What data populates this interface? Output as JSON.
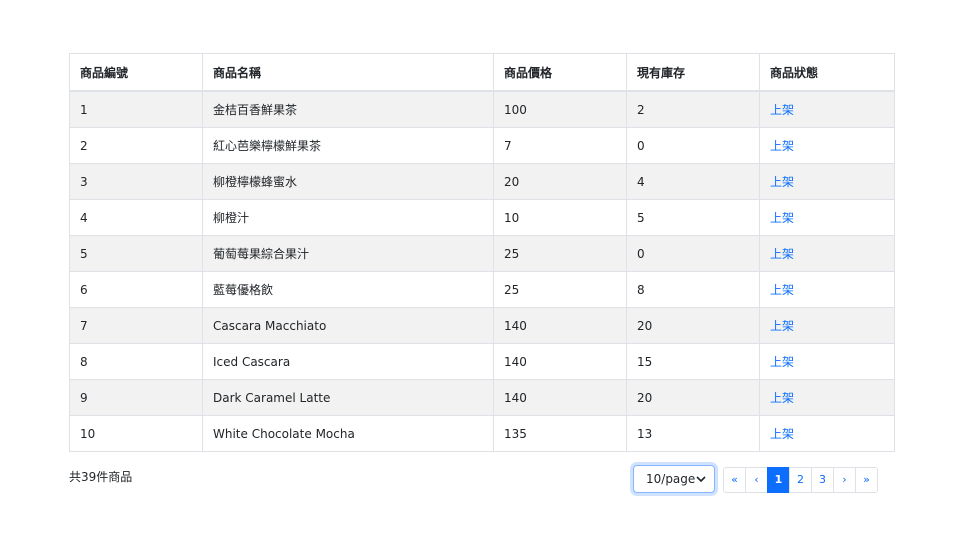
{
  "table": {
    "headers": [
      "商品編號",
      "商品名稱",
      "商品價格",
      "現有庫存",
      "商品狀態"
    ],
    "rows": [
      {
        "id": "1",
        "name": "金桔百香鮮果茶",
        "price": "100",
        "stock": "2",
        "status": "上架"
      },
      {
        "id": "2",
        "name": "紅心芭樂檸檬鮮果茶",
        "price": "7",
        "stock": "0",
        "status": "上架"
      },
      {
        "id": "3",
        "name": "柳橙檸檬蜂蜜水",
        "price": "20",
        "stock": "4",
        "status": "上架"
      },
      {
        "id": "4",
        "name": "柳橙汁",
        "price": "10",
        "stock": "5",
        "status": "上架"
      },
      {
        "id": "5",
        "name": "葡萄莓果綜合果汁",
        "price": "25",
        "stock": "0",
        "status": "上架"
      },
      {
        "id": "6",
        "name": "藍莓優格飲",
        "price": "25",
        "stock": "8",
        "status": "上架"
      },
      {
        "id": "7",
        "name": "Cascara Macchiato",
        "price": "140",
        "stock": "20",
        "status": "上架"
      },
      {
        "id": "8",
        "name": "Iced Cascara",
        "price": "140",
        "stock": "15",
        "status": "上架"
      },
      {
        "id": "9",
        "name": "Dark Caramel Latte",
        "price": "140",
        "stock": "20",
        "status": "上架"
      },
      {
        "id": "10",
        "name": "White Chocolate Mocha",
        "price": "135",
        "stock": "13",
        "status": "上架"
      }
    ]
  },
  "footer": {
    "count_text": "共39件商品",
    "page_size": "10/page",
    "pagination": {
      "first": "«",
      "prev": "‹",
      "pages": [
        "1",
        "2",
        "3"
      ],
      "active_page": "1",
      "next": "›",
      "last": "»"
    }
  },
  "colors": {
    "link": "#0d6efd",
    "active_page_bg": "#0d6efd",
    "striped_row": "#f2f2f2"
  }
}
